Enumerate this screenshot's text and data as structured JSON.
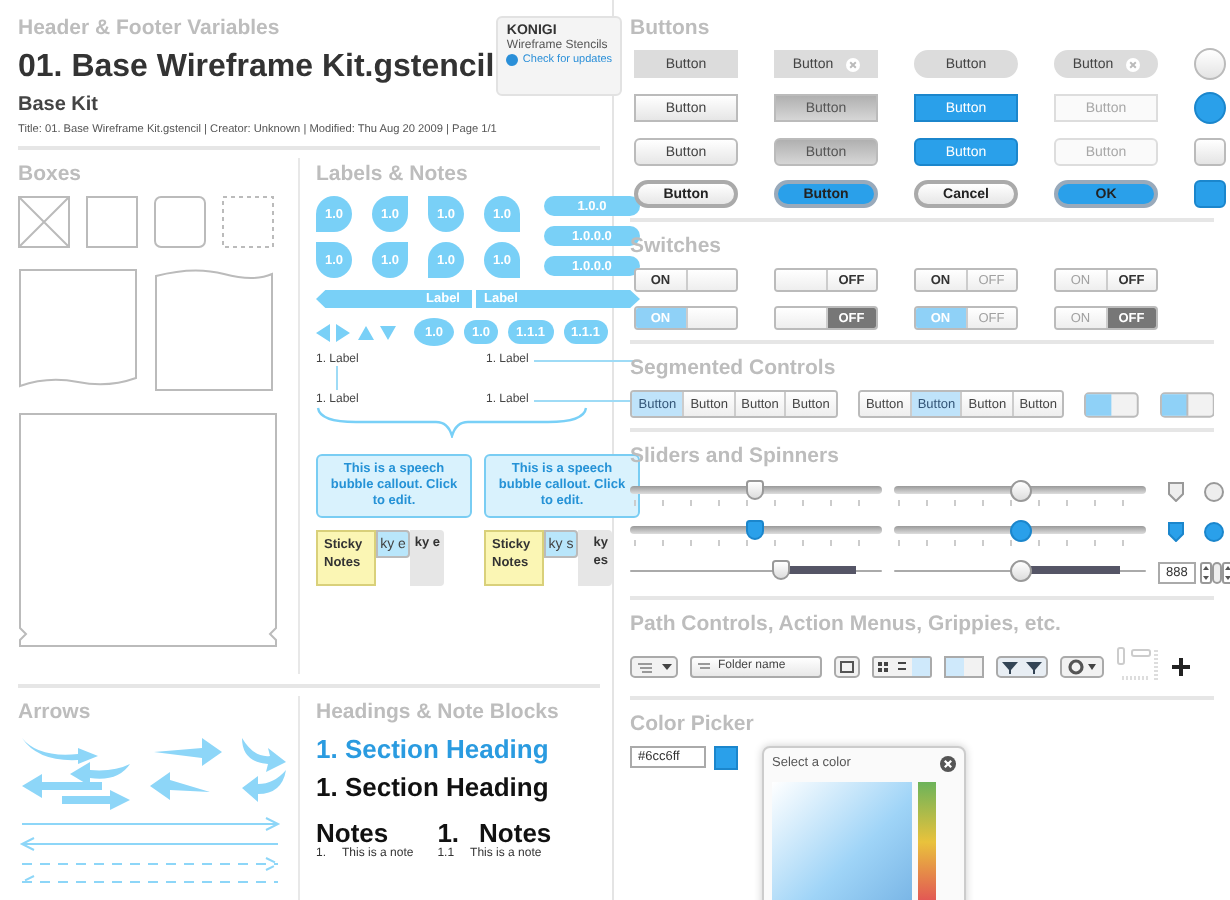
{
  "header": {
    "section_title": "Header & Footer Variables",
    "doc_title": "01. Base Wireframe Kit.gstencil",
    "subtitle": "Base Kit",
    "meta": "Title: 01. Base Wireframe Kit.gstencil  |  Creator: Unknown  |  Modified: Thu Aug 20 2009  |  Page 1/1"
  },
  "badge": {
    "brand": "KONIGI",
    "product": "Wireframe Stencils",
    "link": "Check for updates"
  },
  "boxes": {
    "title": "Boxes"
  },
  "labels": {
    "title": "Labels & Notes",
    "markers": [
      "1.0",
      "1.0",
      "1.0",
      "1.0",
      "1.0",
      "1.0",
      "1.0",
      "1.0"
    ],
    "tags": [
      "1.0.0",
      "1.0.0.0",
      "1.0.0.0"
    ],
    "banners": [
      "Label",
      "Label"
    ],
    "badges": [
      "1.0",
      "1.0",
      "1.1.1",
      "1.1.1"
    ],
    "callouts": [
      "1. Label",
      "1. Label",
      "1. Label",
      "1. Label"
    ],
    "bubbles": [
      "This is a speech bubble callout. Click to edit.",
      "This is a speech bubble callout. Click to edit."
    ],
    "stickies": [
      {
        "front": "Sticky Notes",
        "peeks": [
          "ky e",
          "ky e"
        ]
      },
      {
        "front": "Sticky Notes",
        "peeks": [
          "ky s",
          "ky es"
        ]
      }
    ]
  },
  "arrows": {
    "title": "Arrows"
  },
  "headings": {
    "title": "Headings & Note Blocks",
    "blue_heading": "1. Section Heading",
    "heading": "1. Section Heading",
    "note_blocks": [
      {
        "title": "Notes",
        "item_number": "1.",
        "item": "This is a note"
      },
      {
        "number": "1.",
        "title": "Notes",
        "item_number": "1.1",
        "item": "This is a note"
      }
    ]
  },
  "buttons": {
    "title": "Buttons",
    "items": [
      {
        "label": "Button"
      },
      {
        "label": "Button"
      },
      {
        "label": "Button"
      },
      {
        "label": "Button"
      },
      {
        "label": "Button"
      },
      {
        "label": "Button"
      },
      {
        "label": "Button"
      },
      {
        "label": "Button",
        "disabled": true
      },
      {
        "label": "Button"
      },
      {
        "label": "Button"
      },
      {
        "label": "Button"
      },
      {
        "label": "Button",
        "disabled": true
      },
      {
        "label": "Button"
      },
      {
        "label": "Button"
      },
      {
        "label": "Cancel"
      },
      {
        "label": "OK"
      }
    ],
    "icon_buttons": [
      {
        "selected": false
      },
      {
        "selected": true
      },
      {
        "selected": false
      },
      {
        "selected": true
      }
    ]
  },
  "switches": {
    "title": "Switches",
    "items": [
      {
        "on": true,
        "on_label": "ON"
      },
      {
        "on": false,
        "off_label": "OFF"
      },
      {
        "on": true,
        "on_label": "ON",
        "off_label": "OFF"
      },
      {
        "on": false,
        "on_label": "ON",
        "off_label": "OFF"
      },
      {
        "on": true,
        "on_label": "ON"
      },
      {
        "on": false,
        "off_label": "OFF"
      },
      {
        "on": true,
        "on_label": "ON",
        "off_label": "OFF"
      },
      {
        "on": false,
        "on_label": "ON",
        "off_label": "OFF"
      }
    ]
  },
  "segmented": {
    "title": "Segmented Controls",
    "controls": [
      {
        "segments": [
          {
            "label": "Button",
            "selected": true
          },
          {
            "label": "Button",
            "selected": false
          },
          {
            "label": "Button",
            "selected": false
          },
          {
            "label": "Button",
            "selected": false
          }
        ]
      },
      {
        "segments": [
          {
            "label": "Button",
            "selected": false
          },
          {
            "label": "Button",
            "selected": true
          },
          {
            "label": "Button",
            "selected": false
          },
          {
            "label": "Button",
            "selected": false
          }
        ]
      }
    ]
  },
  "sliders": {
    "title": "Sliders and Spinners",
    "items": [
      {
        "kind": "track",
        "active": false,
        "level": 0.5
      },
      {
        "kind": "track",
        "active": false,
        "level": 0.5
      },
      {
        "kind": "track",
        "active": true,
        "level": 0.5
      },
      {
        "kind": "track",
        "active": true,
        "level": 0.5
      },
      {
        "kind": "thin",
        "active": false,
        "level": 0.6
      },
      {
        "kind": "thin",
        "active": false,
        "level": 0.5
      }
    ],
    "spinner": {
      "value": "888"
    }
  },
  "path_controls": {
    "title": "Path Controls, Action Menus, Grippies, etc.",
    "path_popup": {
      "value": "Folder name"
    }
  },
  "color_picker": {
    "title": "Color Picker",
    "field": {
      "value": "#6cc6ff"
    },
    "popup": {
      "title": "Select a color"
    }
  }
}
